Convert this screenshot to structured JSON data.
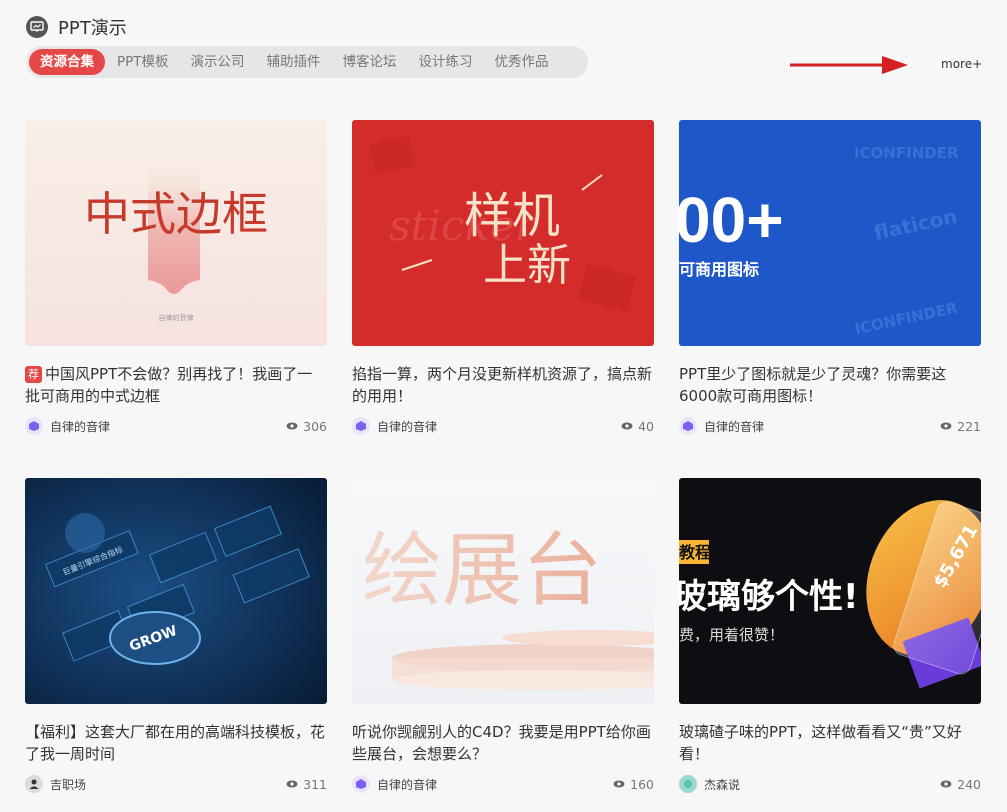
{
  "section": {
    "title": "PPT演示",
    "icon": "presentation-icon"
  },
  "tabs": [
    "资源合集",
    "PPT模板",
    "演示公司",
    "辅助插件",
    "博客论坛",
    "设计练习",
    "优秀作品"
  ],
  "more_label": "more+",
  "colors": {
    "accent": "#e54646",
    "arrow": "#d42020"
  },
  "cards": [
    {
      "badge": "荐",
      "title": "中国风PPT不会做？别再找了！我画了一批可商用的中式边框",
      "author": "自律的音律",
      "views": "306",
      "thumb_text": "中式边框",
      "thumb_small": "自律的音律"
    },
    {
      "title": "掐指一算，两个月没更新样机资源了，搞点新的用用！",
      "author": "自律的音律",
      "views": "40",
      "thumb_text_1": "样机",
      "thumb_text_2": "上新",
      "thumb_bg_text": "sticker"
    },
    {
      "title": "PPT里少了图标就是少了灵魂？你需要这6000款可商用图标！",
      "author": "自律的音律",
      "views": "221",
      "thumb_big": "00+",
      "thumb_sub": "可商用图标",
      "thumb_brand_1": "ICONFINDER",
      "thumb_brand_2": "flaticon",
      "thumb_brand_3": "ICONFINDER"
    },
    {
      "title": "【福利】这套大厂都在用的高端科技模板，花了我一周时间",
      "author": "吉职场",
      "views": "311",
      "thumb_label": "GROW",
      "thumb_small": "巨量引擎综合指标"
    },
    {
      "title": "听说你觊觎别人的C4D？我要是用PPT给你画些展台，会想要么？",
      "author": "自律的音律",
      "views": "160",
      "thumb_text": "绘展台"
    },
    {
      "title": "玻璃碴子味的PPT，这样做看看又“贵”又好看！",
      "author": "杰森说",
      "views": "240",
      "thumb_tag": "教程",
      "thumb_text": "玻璃够个性!",
      "thumb_sub": "费，用着很赞！",
      "thumb_price": "$5,671"
    }
  ]
}
